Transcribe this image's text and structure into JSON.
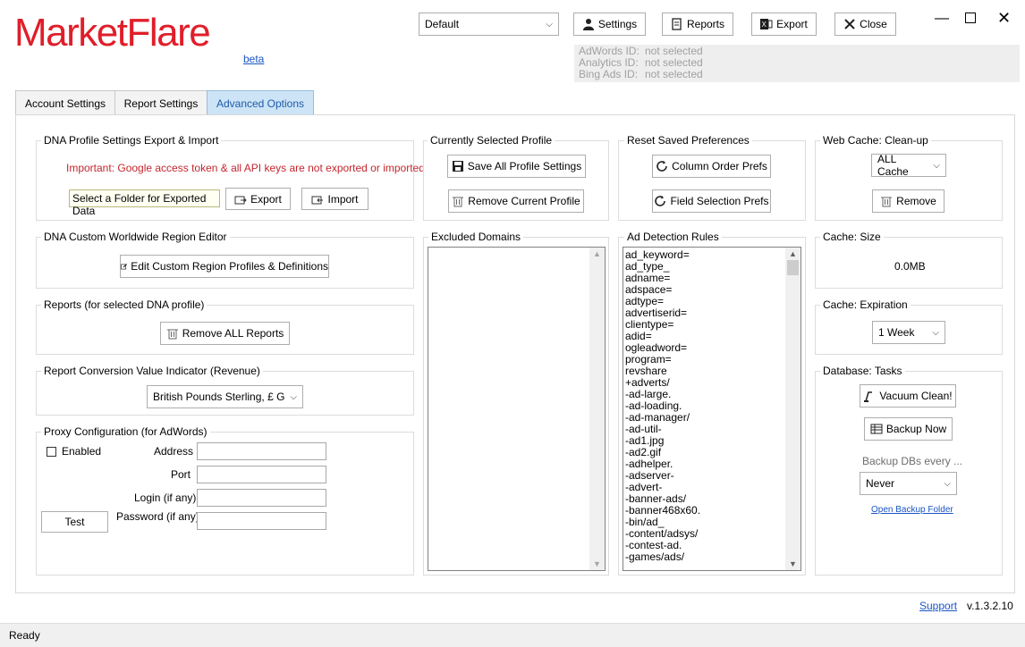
{
  "app": {
    "logo": "MarketFlare",
    "beta": "beta",
    "version": "v.1.3.2.10",
    "support": "Support",
    "status": "Ready"
  },
  "profile_select": "Default",
  "toolbar": {
    "settings": "Settings",
    "reports": "Reports",
    "export": "Export",
    "close": "Close"
  },
  "ids": [
    {
      "label": "AdWords ID:",
      "value": "not selected"
    },
    {
      "label": "Analytics ID:",
      "value": "not selected"
    },
    {
      "label": "Bing Ads ID:",
      "value": "not selected"
    }
  ],
  "tabs": [
    "Account Settings",
    "Report Settings",
    "Advanced Options"
  ],
  "dna_export": {
    "title": "DNA Profile Settings Export & Import",
    "warning": "Important: Google access token & all API keys are not exported or imported",
    "folder_value": "Select a Folder for Exported Data",
    "export": "Export",
    "import": "Import"
  },
  "region_editor": {
    "title": "DNA Custom Worldwide Region Editor",
    "button": "Edit Custom Region Profiles & Definitions"
  },
  "reports": {
    "title": "Reports (for selected DNA profile)",
    "button": "Remove ALL Reports"
  },
  "conversion": {
    "title": "Report Conversion Value Indicator (Revenue)",
    "value": "British Pounds Sterling, £ GBP"
  },
  "proxy": {
    "title": "Proxy Configuration (for AdWords)",
    "enabled": "Enabled",
    "address": "Address",
    "port": "Port",
    "login": "Login (if any)",
    "password": "Password (if any)",
    "test": "Test"
  },
  "current_profile": {
    "title": "Currently Selected Profile",
    "save": "Save All Profile Settings",
    "remove": "Remove Current Profile"
  },
  "excluded": {
    "title": "Excluded Domains"
  },
  "reset": {
    "title": "Reset Saved Preferences",
    "column": "Column Order Prefs",
    "field": "Field Selection Prefs"
  },
  "ad_rules": {
    "title": "Ad Detection Rules",
    "items": [
      "ad_keyword=",
      "ad_type_",
      "adname=",
      "adspace=",
      "adtype=",
      "advertiserid=",
      "clientype=",
      "adid=",
      "ogleadword=",
      "program=",
      "revshare",
      "+adverts/",
      "-ad-large.",
      "-ad-loading.",
      "-ad-manager/",
      "-ad-util-",
      "-ad1.jpg",
      "-ad2.gif",
      "-adhelper.",
      "-adserver-",
      "-advert-",
      "-banner-ads/",
      "-banner468x60.",
      "-bin/ad_",
      "-content/adsys/",
      "-contest-ad.",
      "-games/ads/"
    ]
  },
  "web_cache": {
    "title": "Web Cache: Clean-up",
    "select": "ALL Cache",
    "remove": "Remove"
  },
  "cache_size": {
    "title": "Cache: Size",
    "value": "0.0MB"
  },
  "cache_exp": {
    "title": "Cache: Expiration",
    "value": "1 Week"
  },
  "db_tasks": {
    "title": "Database: Tasks",
    "vacuum": "Vacuum Clean!",
    "backup": "Backup Now",
    "backup_every": "Backup DBs every ...",
    "backup_select": "Never",
    "open_folder": "Open Backup Folder"
  },
  "colors": {
    "logo": "#e01e2a",
    "active_tab_bg": "#cde4f7",
    "warning": "#c4262e",
    "link": "#1a55c4"
  }
}
